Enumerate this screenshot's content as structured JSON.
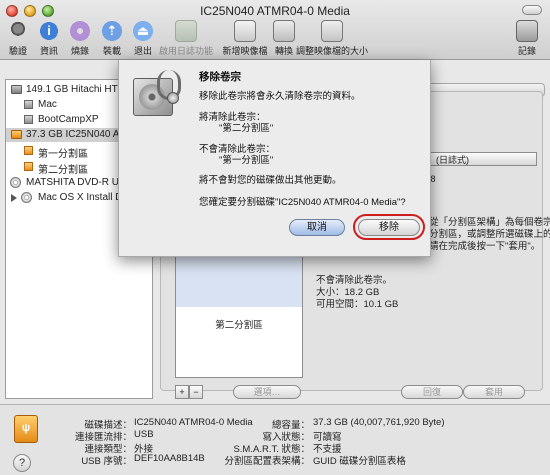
{
  "window": {
    "title": "IC25N040 ATMR04-0 Media"
  },
  "toolbar": {
    "verify": "驗證",
    "info": "資訊",
    "burn": "燒錄",
    "mount": "裝載",
    "eject": "退出",
    "journal": "啟用日誌功能",
    "new_image": "新增映像檔",
    "convert": "轉換",
    "resize_image": "調整映像檔的大小",
    "log": "記錄"
  },
  "sidebar": {
    "items": [
      {
        "label": "149.1 GB Hitachi HTS5",
        "kind": "disk"
      },
      {
        "label": "Mac",
        "kind": "volume"
      },
      {
        "label": "BootCampXP",
        "kind": "volume"
      },
      {
        "label": "37.3 GB IC25N040 ATMR",
        "kind": "disk"
      },
      {
        "label": "第一分割區",
        "kind": "volume"
      },
      {
        "label": "第二分割區",
        "kind": "volume"
      },
      {
        "label": "MATSHITA DVD-R UJ-",
        "kind": "optical"
      },
      {
        "label": "Mac OS X Install DVD",
        "kind": "optical"
      }
    ]
  },
  "main": {
    "format_value": "(日誌式)",
    "size_value": "8",
    "description_lines": [
      "從「分割區架構」為每個卷宗設",
      "分割區，或調整所選磁碟上的卷宗",
      "請在完成後按一下\"套用\"。"
    ],
    "partition_map_label": "第二分割區",
    "no_erase_label": "不會清除此卷宗。",
    "size_label": "大小：18.2 GB",
    "available_label": "可用空間：10.1 GB",
    "add_symbol": "+",
    "remove_symbol": "−",
    "options_button": "選項…",
    "revert_button": "回復",
    "apply_button": "套用"
  },
  "bottom_info": {
    "disk_description_key": "磁碟描述：",
    "disk_description_val": "IC25N040 ATMR04-0 Media",
    "bus_key": "連接匯流排：",
    "bus_val": "USB",
    "type_key": "連接類型：",
    "type_val": "外接",
    "serial_key": "USB 序號：",
    "serial_val": "DEF10AA8B14B",
    "capacity_key": "總容量：",
    "capacity_val": "37.3 GB (40,007,761,920 Byte)",
    "write_key": "寫入狀態：",
    "write_val": "可讀寫",
    "smart_key": "S.M.A.R.T. 狀態：",
    "smart_val": "不支援",
    "scheme_key": "分割區配置表架構：",
    "scheme_val": "GUID 磁碟分割區表格",
    "help": "?"
  },
  "dialog": {
    "title": "移除卷宗",
    "warning": "移除此卷宗將會永久清除卷宗的資料。",
    "will_erase": "將清除此卷宗：",
    "will_erase_name": "\"第二分割區\"",
    "will_not_erase": "不會清除此卷宗：",
    "will_not_erase_name": "\"第一分割區\"",
    "others_note": "將不會對您的磁碟做出其他更動。",
    "confirm": "您確定要分割磁碟\"IC25N040 ATMR04-0 Media\"?",
    "cancel": "取消",
    "remove": "移除"
  }
}
